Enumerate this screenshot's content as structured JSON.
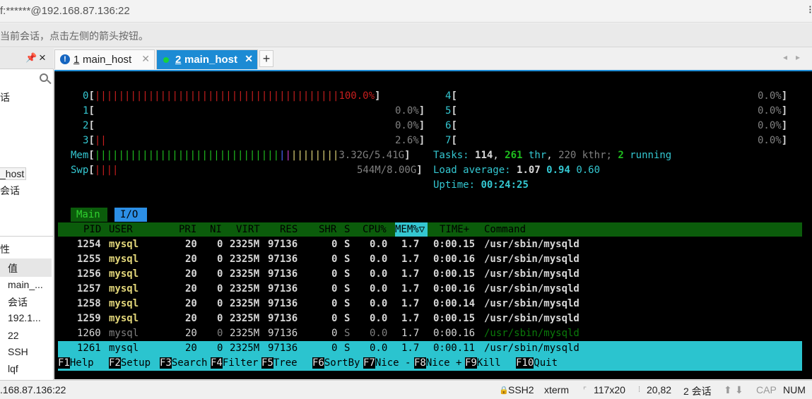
{
  "window": {
    "title": "f:******@192.168.87.136:22",
    "hint": "当前会话，点击左侧的箭头按钮。"
  },
  "left_panel": {
    "pin_icon": "pin-icon",
    "close_label": "×",
    "session_items": [
      "话",
      "_host",
      "会话"
    ],
    "property_header": "性",
    "property_rows": [
      "值",
      "main_...",
      "会话",
      "192.1...",
      "22",
      "SSH",
      "lqf"
    ]
  },
  "tabs": [
    {
      "number": "1",
      "label": "main_host",
      "status_icon": "info-icon",
      "active": false
    },
    {
      "number": "2",
      "label": "main_host",
      "status_icon": "connected-dot-icon",
      "active": true
    }
  ],
  "new_tab_label": "+",
  "tab_nav": [
    "◂",
    "▸"
  ],
  "htop": {
    "cpus_left": [
      {
        "id": "0",
        "bars": "|||||||||||||||||||||||||||||||||||||||||",
        "percent": "100.0%"
      },
      {
        "id": "1",
        "bars": "",
        "percent": "0.0%"
      },
      {
        "id": "2",
        "bars": "",
        "percent": "0.0%"
      },
      {
        "id": "3",
        "bars": "||",
        "percent": "2.6%"
      }
    ],
    "cpus_right": [
      {
        "id": "4",
        "percent": "0.0%"
      },
      {
        "id": "5",
        "percent": "0.0%"
      },
      {
        "id": "6",
        "percent": "0.0%"
      },
      {
        "id": "7",
        "percent": "0.0%"
      }
    ],
    "mem": {
      "label": "Mem",
      "bars_green": "|||||||||||||||||||||||||||||||",
      "bars_blue": "|",
      "bars_pink": "|",
      "bars_yellow": "||||||||",
      "value": "3.32G/5.41G"
    },
    "swp": {
      "label": "Swp",
      "bars": "||||",
      "value": "544M/8.00G"
    },
    "tasks": {
      "label": "Tasks:",
      "count": "114",
      "thr": "261",
      "thr_label": "thr",
      "kthr": "220 kthr;",
      "running": "2",
      "running_label": "running"
    },
    "load": {
      "label": "Load average:",
      "v1": "1.07",
      "v5": "0.94",
      "v15": "0.60"
    },
    "uptime": {
      "label": "Uptime:",
      "value": "00:24:25"
    },
    "view_tabs": [
      "Main",
      "I/O"
    ],
    "columns": [
      "PID",
      "USER",
      "PRI",
      "NI",
      "VIRT",
      "RES",
      "SHR",
      "S",
      "CPU%",
      "MEM%▽",
      "TIME+",
      "Command"
    ],
    "processes": [
      {
        "pid": "1254",
        "user": "mysql",
        "pri": "20",
        "ni": "0",
        "virt": "2325M",
        "res": "97136",
        "shr": "0",
        "s": "S",
        "cpu": "0.0",
        "mem": "1.7",
        "time": "0:00.15",
        "cmd": "/usr/sbin/mysqld"
      },
      {
        "pid": "1255",
        "user": "mysql",
        "pri": "20",
        "ni": "0",
        "virt": "2325M",
        "res": "97136",
        "shr": "0",
        "s": "S",
        "cpu": "0.0",
        "mem": "1.7",
        "time": "0:00.16",
        "cmd": "/usr/sbin/mysqld"
      },
      {
        "pid": "1256",
        "user": "mysql",
        "pri": "20",
        "ni": "0",
        "virt": "2325M",
        "res": "97136",
        "shr": "0",
        "s": "S",
        "cpu": "0.0",
        "mem": "1.7",
        "time": "0:00.15",
        "cmd": "/usr/sbin/mysqld"
      },
      {
        "pid": "1257",
        "user": "mysql",
        "pri": "20",
        "ni": "0",
        "virt": "2325M",
        "res": "97136",
        "shr": "0",
        "s": "S",
        "cpu": "0.0",
        "mem": "1.7",
        "time": "0:00.16",
        "cmd": "/usr/sbin/mysqld"
      },
      {
        "pid": "1258",
        "user": "mysql",
        "pri": "20",
        "ni": "0",
        "virt": "2325M",
        "res": "97136",
        "shr": "0",
        "s": "S",
        "cpu": "0.0",
        "mem": "1.7",
        "time": "0:00.14",
        "cmd": "/usr/sbin/mysqld"
      },
      {
        "pid": "1259",
        "user": "mysql",
        "pri": "20",
        "ni": "0",
        "virt": "2325M",
        "res": "97136",
        "shr": "0",
        "s": "S",
        "cpu": "0.0",
        "mem": "1.7",
        "time": "0:00.15",
        "cmd": "/usr/sbin/mysqld"
      },
      {
        "pid": "1260",
        "user": "mysql",
        "pri": "20",
        "ni": "0",
        "virt": "2325M",
        "res": "97136",
        "shr": "0",
        "s": "S",
        "cpu": "0.0",
        "mem": "1.7",
        "time": "0:00.16",
        "cmd": "/usr/sbin/mysqld"
      },
      {
        "pid": "1261",
        "user": "mysql",
        "pri": "20",
        "ni": "0",
        "virt": "2325M",
        "res": "97136",
        "shr": "0",
        "s": "S",
        "cpu": "0.0",
        "mem": "1.7",
        "time": "0:00.11",
        "cmd": "/usr/sbin/mysqld"
      }
    ],
    "function_keys": [
      {
        "key": "F1",
        "label": "Help"
      },
      {
        "key": "F2",
        "label": "Setup"
      },
      {
        "key": "F3",
        "label": "Search"
      },
      {
        "key": "F4",
        "label": "Filter"
      },
      {
        "key": "F5",
        "label": "Tree"
      },
      {
        "key": "F6",
        "label": "SortBy"
      },
      {
        "key": "F7",
        "label": "Nice -"
      },
      {
        "key": "F8",
        "label": "Nice +"
      },
      {
        "key": "F9",
        "label": "Kill"
      },
      {
        "key": "F10",
        "label": "Quit"
      }
    ]
  },
  "statusbar": {
    "host": ".168.87.136:22",
    "protocol": "SSH2",
    "term": "xterm",
    "size": "117x20",
    "cursor": "20,82",
    "sessions": "2 会话",
    "caps": "CAP",
    "num": "NUM"
  },
  "colors": {
    "tab_active": "#1c8bd4",
    "terminal_bg": "#000000",
    "htop_green": "#1fbf1f",
    "htop_cyan": "#34c7d1",
    "selected_row": "#2bc4cf"
  }
}
